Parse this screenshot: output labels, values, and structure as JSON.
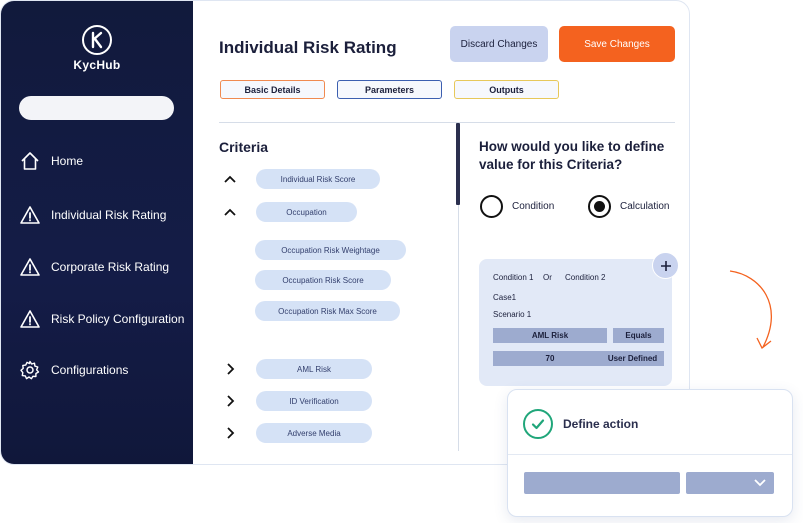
{
  "brand": {
    "name": "KycHub"
  },
  "sidebar": {
    "search_value": "",
    "items": [
      {
        "label": "Home",
        "icon": "home-icon"
      },
      {
        "label": "Individual Risk Rating",
        "icon": "warning-icon"
      },
      {
        "label": "Corporate Risk Rating",
        "icon": "warning-icon"
      },
      {
        "label": "Risk Policy Configuration",
        "icon": "warning-icon"
      },
      {
        "label": "Configurations",
        "icon": "gear-icon"
      }
    ]
  },
  "header": {
    "title": "Individual Risk Rating",
    "discard_label": "Discard Changes",
    "save_label": "Save Changes"
  },
  "tabs": [
    {
      "label": "Basic Details"
    },
    {
      "label": "Parameters"
    },
    {
      "label": "Outputs"
    }
  ],
  "criteria": {
    "title": "Criteria",
    "items": [
      {
        "label": "Individual Risk Score",
        "expanded": true
      },
      {
        "label": "Occupation",
        "expanded": true
      },
      {
        "label": "Occupation Risk Weightage"
      },
      {
        "label": "Occupation Risk Score"
      },
      {
        "label": "Occupation Risk Max Score"
      },
      {
        "label": "AML Risk",
        "expanded": false
      },
      {
        "label": "ID Verification",
        "expanded": false
      },
      {
        "label": "Adverse Media",
        "expanded": false
      }
    ]
  },
  "definition": {
    "question": "How would you like to define value for this Criteria?",
    "options": [
      {
        "label": "Condition",
        "selected": false
      },
      {
        "label": "Calculation",
        "selected": true
      }
    ]
  },
  "condition_card": {
    "condition1": "Condition 1",
    "or": "Or",
    "condition2": "Condition 2",
    "case": "Case1",
    "scenario": "Scenario 1",
    "field": "AML Risk",
    "operator": "Equals",
    "value": "70",
    "value_type": "User Defined"
  },
  "popup": {
    "title": "Define action"
  },
  "colors": {
    "sidebar_bg": "#141c47",
    "accent_orange": "#f4621f",
    "pill_bg": "#d5e2f6",
    "cell_bg": "#9dabcf",
    "success": "#20a67a"
  }
}
